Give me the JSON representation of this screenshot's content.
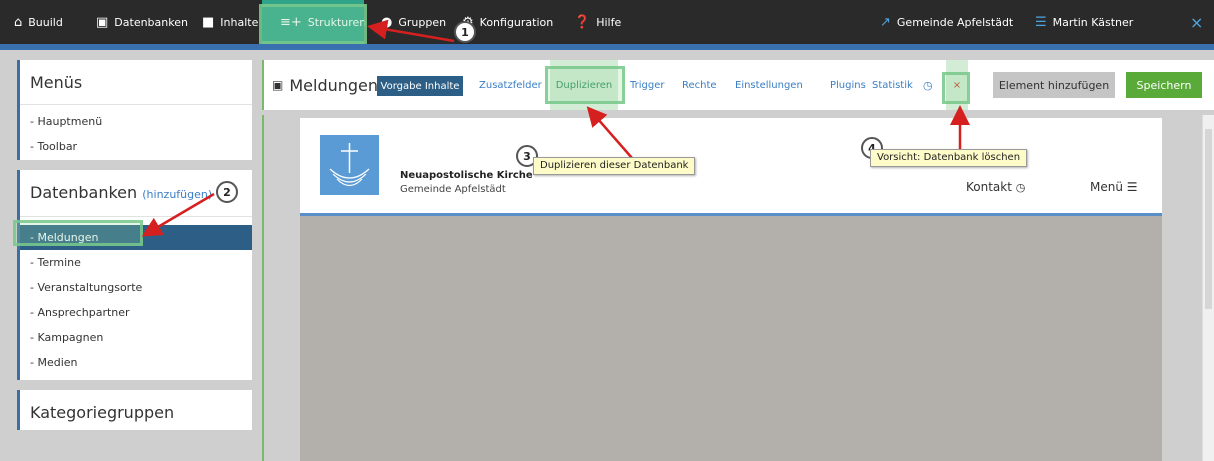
{
  "topnav": {
    "items": [
      {
        "label": "Buuild",
        "icon": "home-icon"
      },
      {
        "label": "Datenbanken",
        "icon": "calendar-icon"
      },
      {
        "label": "Inhalte",
        "icon": "folder-icon"
      },
      {
        "label": "Strukturen",
        "icon": "structure-icon"
      },
      {
        "label": "Gruppen",
        "icon": "users-icon"
      },
      {
        "label": "Konfiguration",
        "icon": "gear-icon"
      },
      {
        "label": "Hilfe",
        "icon": "help-icon"
      }
    ],
    "active": "Strukturen",
    "site": "Gemeinde Apfelstädt",
    "user": "Martin Kästner",
    "close": "×"
  },
  "sidebar": {
    "menus": {
      "title": "Menüs",
      "items": [
        "- Hauptmenü",
        "- Toolbar"
      ]
    },
    "databases": {
      "title": "Datenbanken",
      "add_label": "(hinzufügen)",
      "items": [
        "- Meldungen",
        "- Termine",
        "- Veranstaltungsorte",
        "- Ansprechpartner",
        "- Kampagnen",
        "- Medien"
      ],
      "active": "- Meldungen"
    },
    "categories": {
      "title": "Kategoriegruppen"
    }
  },
  "main": {
    "title": "Meldungen",
    "tabs": {
      "vorgabe": "Vorgabe Inhalte",
      "zusatz": "Zusatzfelder",
      "duplizieren": "Duplizieren",
      "trigger": "Trigger",
      "rechte": "Rechte",
      "einstellungen": "Einstellungen",
      "plugins": "Plugins",
      "statistik": "Statistik",
      "delete": "×"
    },
    "add_element": "Element hinzufügen",
    "save": "Speichern"
  },
  "preview": {
    "org": "Neuapostolische Kirche",
    "sub": "Gemeinde Apfelstädt",
    "contact": "Kontakt",
    "menu": "Menü"
  },
  "annotations": {
    "n1": "1",
    "n2": "2",
    "n3": "3",
    "n4": "4",
    "tip3": "Duplizieren dieser Datenbank",
    "tip4": "Vorsicht: Datenbank löschen"
  },
  "colors": {
    "navbar": "#2a2a2a",
    "active_nav": "#2fa489",
    "primary": "#2d5f86",
    "save": "#5aaa3a",
    "arrow": "#d62020"
  }
}
